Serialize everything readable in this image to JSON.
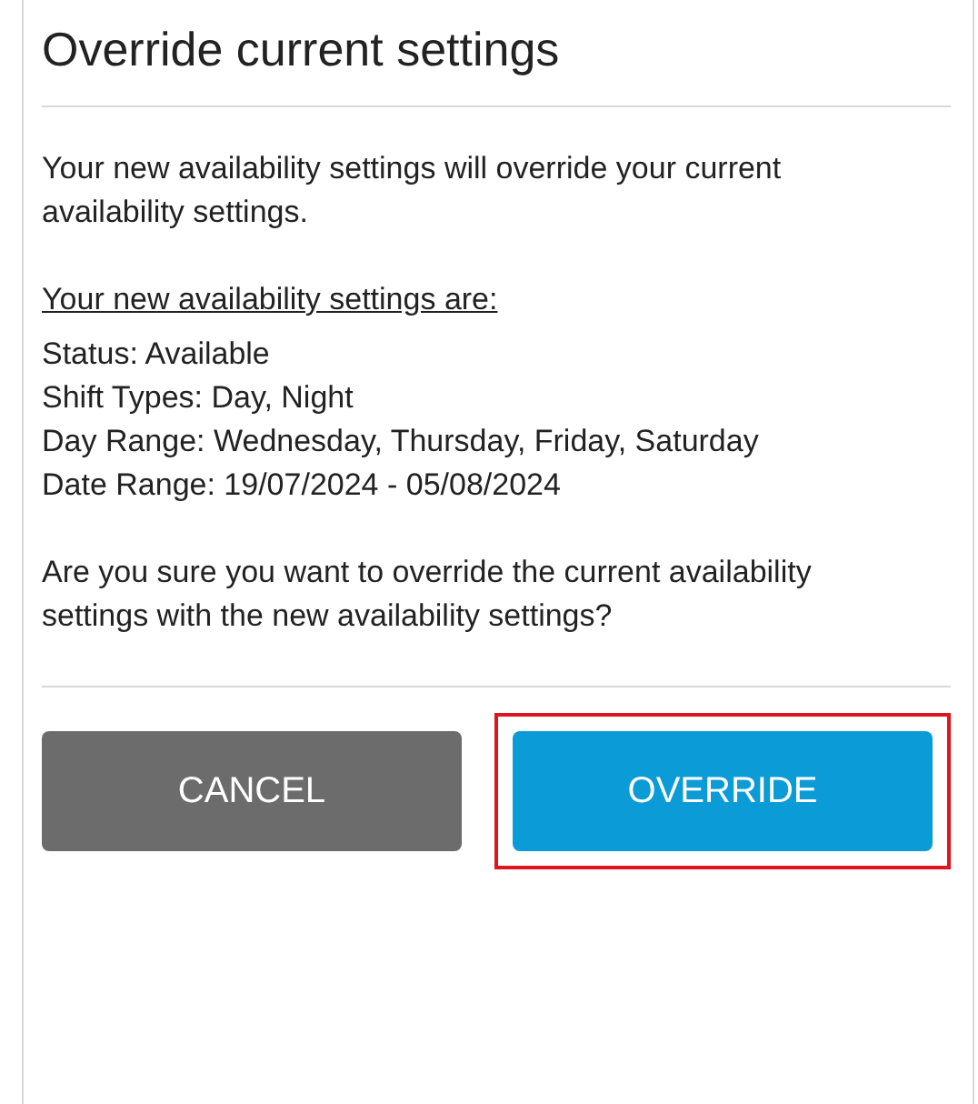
{
  "dialog": {
    "title": "Override current settings",
    "intro": "Your new availability settings will override your current availability settings.",
    "summary_heading": "Your new availability settings are:",
    "summary_lines": [
      "Status: Available",
      "Shift Types: Day, Night",
      "Day Range: Wednesday, Thursday, Friday, Saturday",
      "Date Range: 19/07/2024 - 05/08/2024"
    ],
    "question": "Are you sure you want to override the current availability settings with the new availability settings?",
    "buttons": [
      {
        "label": "CANCEL",
        "kind": "secondary",
        "highlighted": false
      },
      {
        "label": "OVERRIDE",
        "kind": "primary",
        "highlighted": true
      }
    ]
  }
}
